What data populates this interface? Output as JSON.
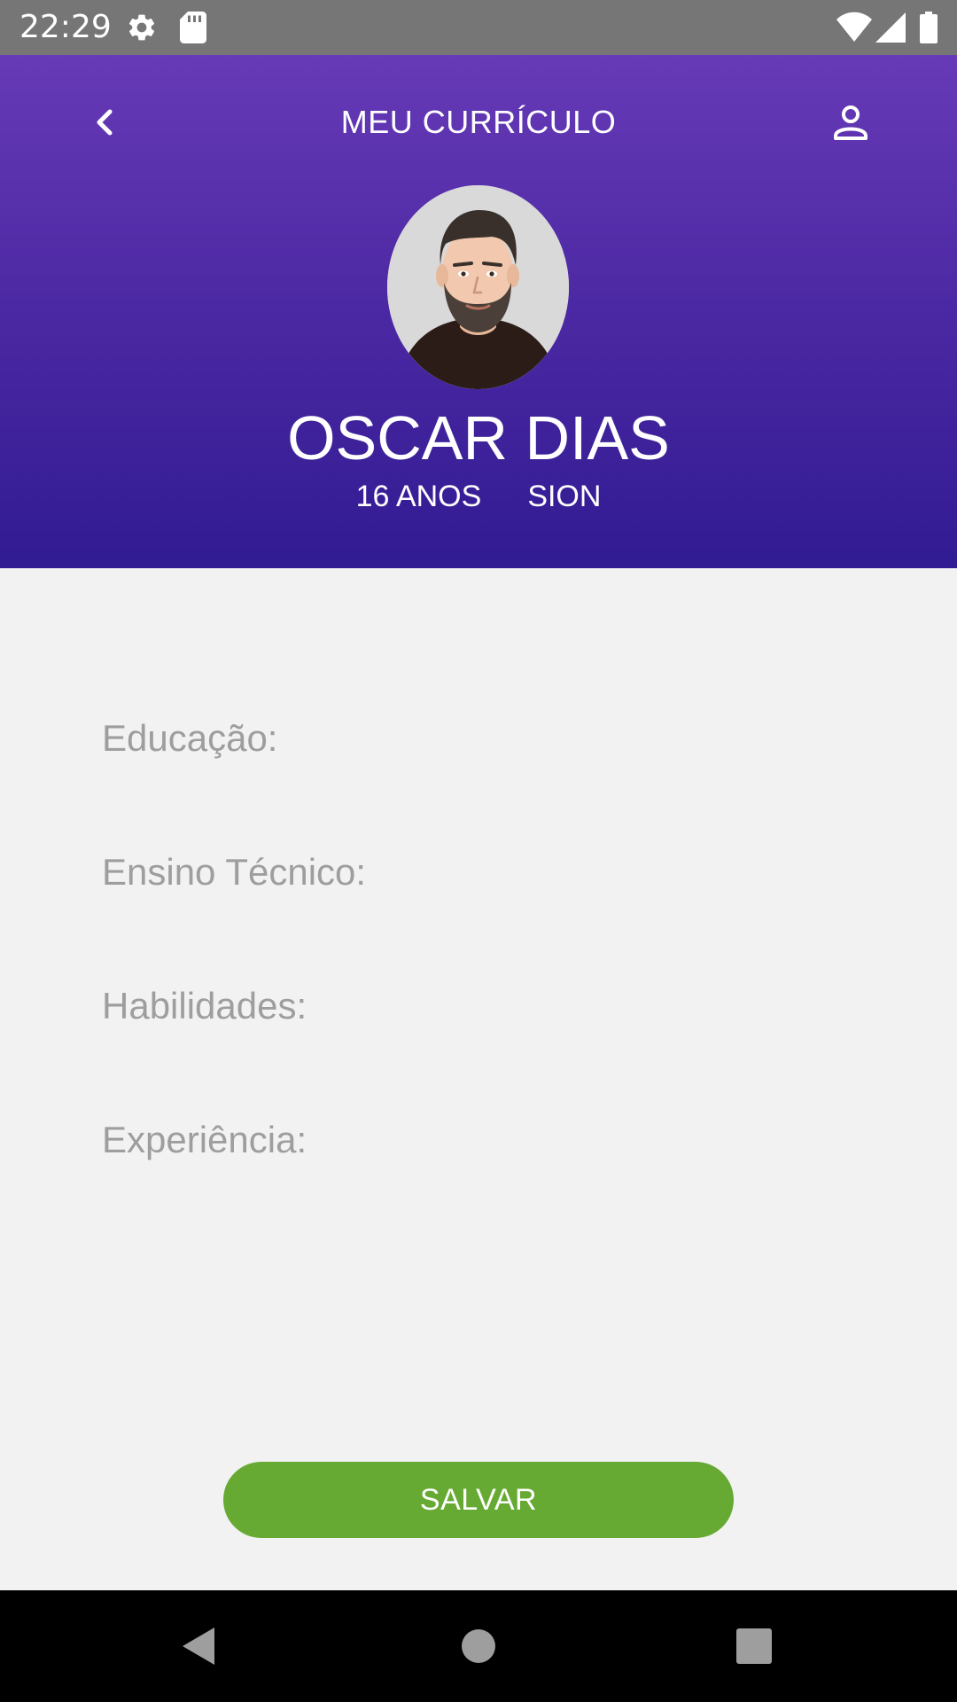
{
  "status_bar": {
    "time": "22:29",
    "icons": [
      "gear-icon",
      "sd-card-icon",
      "wifi-icon",
      "signal-icon",
      "battery-icon"
    ]
  },
  "header": {
    "title": "MEU CURRÍCULO",
    "back_icon": "chevron-left-icon",
    "profile_icon": "person-icon",
    "gradient_top": "#673ab7",
    "gradient_bottom": "#311b92"
  },
  "profile": {
    "name": "OSCAR DIAS",
    "age": "16 ANOS",
    "location": "SION"
  },
  "fields": [
    {
      "label": "Educação:"
    },
    {
      "label": "Ensino Técnico:"
    },
    {
      "label": "Habilidades:"
    },
    {
      "label": "Experiência:"
    }
  ],
  "save_button": {
    "label": "SALVAR",
    "color": "#66aa33"
  },
  "nav_bar": {
    "icons": [
      "back-triangle-icon",
      "home-circle-icon",
      "recents-square-icon"
    ]
  }
}
